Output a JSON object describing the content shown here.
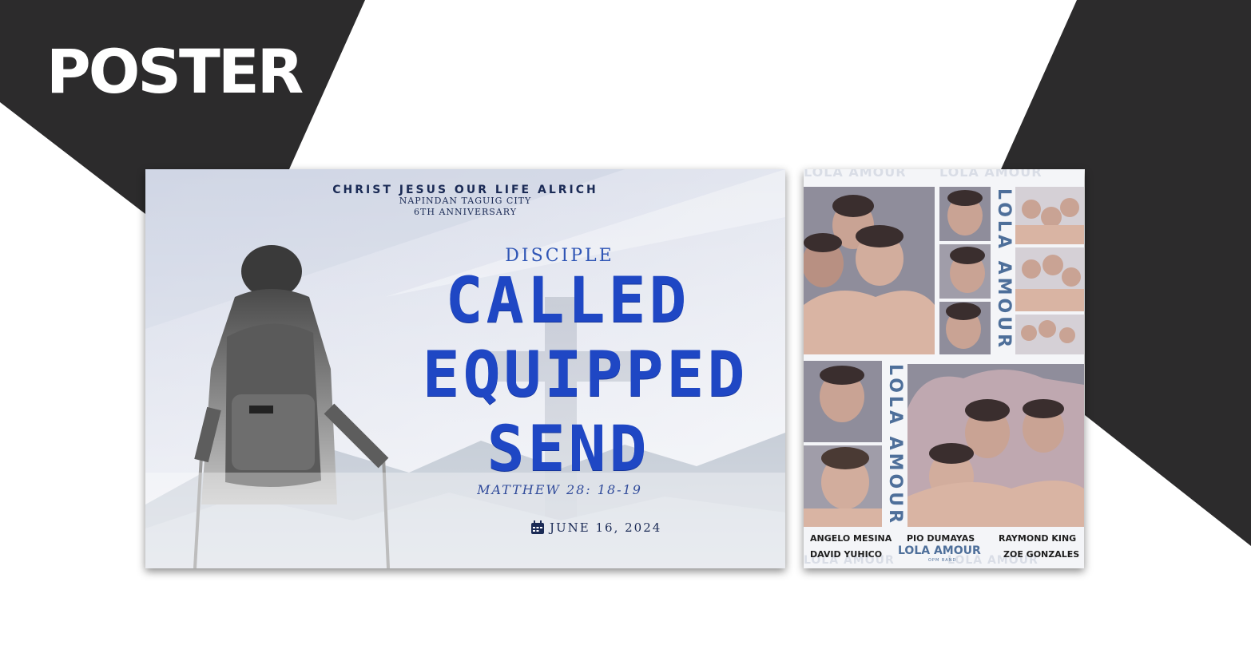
{
  "page": {
    "heading": "POSTER",
    "colors": {
      "dark": "#2c2b2c",
      "white": "#ffffff"
    }
  },
  "poster_disciple": {
    "church": "CHRIST JESUS OUR LIFE ALRICH",
    "location": "NAPINDAN TAGUIG CITY",
    "anniversary": "6TH ANNIVERSARY",
    "eyebrow": "DISCIPLE",
    "words": [
      "CALLED",
      "EQUIPPED",
      "SEND"
    ],
    "verse": "MATTHEW 28: 18-19",
    "date": "JUNE 16, 2024",
    "date_icon": "calendar-icon",
    "colors": {
      "title": "#1f47c4",
      "navy": "#1a2a55"
    }
  },
  "poster_band": {
    "watermark": "LOLA AMOUR",
    "vertical_title": "LOLA AMOUR",
    "band_name": "LOLA AMOUR",
    "band_subtitle": "OPM BAND",
    "members": [
      "ANGELO MESINA",
      "PIO DUMAYAS",
      "RAYMOND KING",
      "DAVID YUHICO",
      "ZOE GONZALES"
    ],
    "colors": {
      "accent": "#4e6f9a",
      "skin": "#c9a394",
      "shade": "#8f8d9b"
    }
  }
}
